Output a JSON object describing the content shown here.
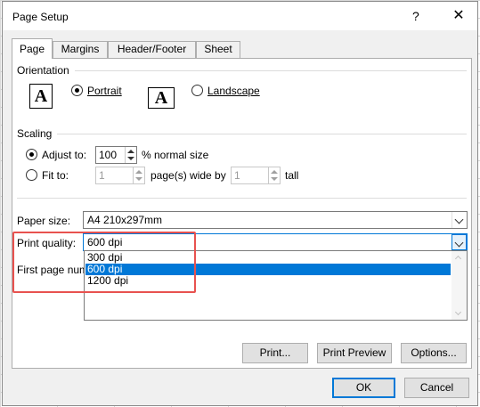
{
  "dialog": {
    "title": "Page Setup",
    "help": "?",
    "close": "✕"
  },
  "tabs": [
    "Page",
    "Margins",
    "Header/Footer",
    "Sheet"
  ],
  "orientation": {
    "heading": "Orientation",
    "icon_letter": "A",
    "portrait": "Portrait",
    "landscape": "Landscape",
    "selected": "portrait"
  },
  "scaling": {
    "heading": "Scaling",
    "adjust_to": "Adjust to:",
    "adjust_value": "100",
    "normal_size": "% normal size",
    "fit_to": "Fit to:",
    "fit_wide_value": "1",
    "pages_wide_by": "page(s) wide by",
    "fit_tall_value": "1",
    "tall": "tall",
    "selected": "adjust"
  },
  "paper_size": {
    "label": "Paper size:",
    "value": "A4 210x297mm"
  },
  "print_quality": {
    "label": "Print quality:",
    "value": "600 dpi",
    "options": [
      "300 dpi",
      "600 dpi",
      "1200 dpi"
    ],
    "selected_index": 1
  },
  "first_page_number": {
    "label": "First page num"
  },
  "buttons": {
    "print": "Print...",
    "print_preview": "Print Preview",
    "options": "Options...",
    "ok": "OK",
    "cancel": "Cancel"
  },
  "colors": {
    "accent": "#0078d7",
    "highlight": "#e8524f"
  }
}
